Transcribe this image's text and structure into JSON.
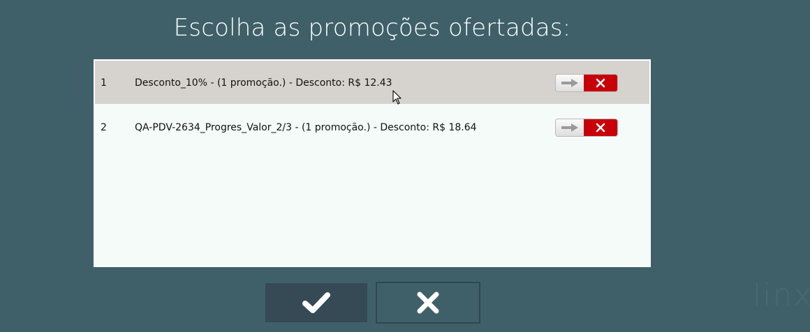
{
  "dialog": {
    "title": "Escolha as promoções ofertadas:"
  },
  "promotions": [
    {
      "index": "1",
      "description": "Desconto_10% - (1 promoção.) - Desconto: R$ 12.43",
      "selected": true
    },
    {
      "index": "2",
      "description": "QA-PDV-2634_Progres_Valor_2/3 - (1 promoção.) - Desconto: R$ 18.64",
      "selected": false
    }
  ],
  "actions": {
    "row_apply_icon": "arrow-right-icon",
    "row_remove_icon": "close-icon",
    "confirm_icon": "checkmark-icon",
    "cancel_icon": "close-icon"
  },
  "branding": {
    "logo_text": "linx"
  },
  "colors": {
    "background": "#3f6068",
    "list_background": "#f5fbf8",
    "selected_row": "#d6d3ce",
    "remove_button": "#c8000a",
    "confirm_button": "#354a55"
  }
}
